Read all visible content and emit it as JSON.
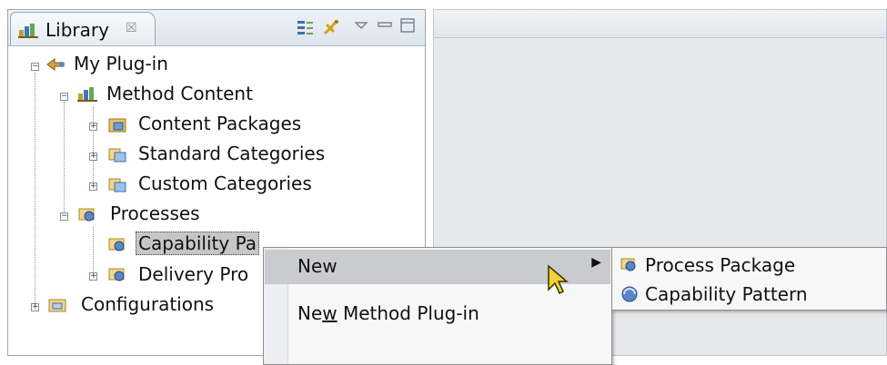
{
  "library_view": {
    "tab_title": "Library",
    "tab_close": "☒"
  },
  "tree": {
    "root": "My Plug-in",
    "method_content": "Method Content",
    "content_packages": "Content Packages",
    "standard_categories": "Standard Categories",
    "custom_categories": "Custom Categories",
    "processes": "Processes",
    "capability_patterns": "Capability Pa",
    "delivery_processes": "Delivery Pro",
    "configurations": "Configurations"
  },
  "context_menu": {
    "new": "New",
    "new_method_plugin_pre": "Ne",
    "new_method_plugin_accel": "w",
    "new_method_plugin_post": " Method Plug-in",
    "submenu_arrow": "▶"
  },
  "submenu": {
    "process_package": "Process Package",
    "capability_pattern": "Capability Pattern"
  },
  "icons": [
    "library-icon",
    "plugin-icon",
    "method-content-icon",
    "package-icon",
    "category-icon",
    "process-icon",
    "configuration-icon",
    "link-editor-icon",
    "sync-icon",
    "view-menu-icon",
    "minimize-icon",
    "maximize-icon",
    "mouse-cursor-icon"
  ]
}
